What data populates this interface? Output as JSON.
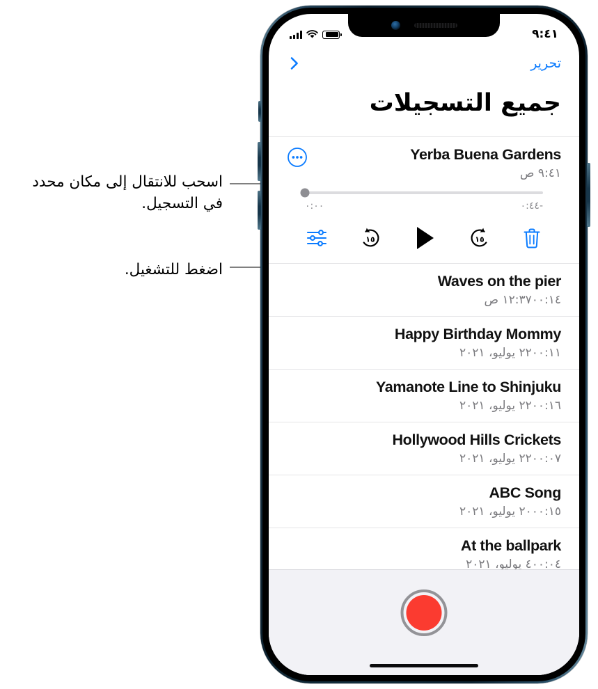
{
  "annotations": [
    {
      "id": "drag-callout",
      "text": "اسحب للانتقال إلى مكان محدد في التسجيل."
    },
    {
      "id": "play-callout",
      "text": "اضغط للتشغيل."
    }
  ],
  "status_bar": {
    "time": "٩:٤١",
    "battery_icon": "battery-icon",
    "wifi_icon": "wifi-icon",
    "cellular_icon": "cellular-signal-icon"
  },
  "nav": {
    "edit_label": "تحرير",
    "back_icon": "chevron-right-icon"
  },
  "header": {
    "title": "جميع التسجيلات"
  },
  "player": {
    "more_icon": "more-circle-icon",
    "elapsed": "٠:٠٠",
    "remaining": "-٠:٤٤",
    "progress_percent": 0,
    "controls": [
      {
        "name": "delete-button",
        "icon": "trash-icon",
        "label": "حذف",
        "color": "#0a7bff"
      },
      {
        "name": "skip-back-button",
        "icon": "skip-back-15-icon",
        "label": "١٥",
        "color": "#000000"
      },
      {
        "name": "play-button",
        "icon": "play-icon",
        "label": "تشغيل",
        "color": "#000000"
      },
      {
        "name": "skip-forward-button",
        "icon": "skip-forward-15-icon",
        "label": "١٥",
        "color": "#000000"
      },
      {
        "name": "options-button",
        "icon": "sliders-icon",
        "label": "خيارات",
        "color": "#0a7bff"
      }
    ]
  },
  "recordings": [
    {
      "title": "Yerba Buena Gardens",
      "date": "٩:٤١ ص",
      "duration": "",
      "selected": true
    },
    {
      "title": "Waves on the pier",
      "date": "١٢:٣٧ ص",
      "duration": "٠٠:١٤",
      "selected": false
    },
    {
      "title": "Happy Birthday Mommy",
      "date": "٢٢ يوليو، ٢٠٢١",
      "duration": "٠٠:١١",
      "selected": false
    },
    {
      "title": "Yamanote Line to Shinjuku",
      "date": "٢٢ يوليو، ٢٠٢١",
      "duration": "٠٠:١٦",
      "selected": false
    },
    {
      "title": "Hollywood Hills Crickets",
      "date": "٢٢ يوليو، ٢٠٢١",
      "duration": "٠٠:٠٧",
      "selected": false
    },
    {
      "title": "ABC Song",
      "date": "٢٠ يوليو، ٢٠٢١",
      "duration": "٠٠:١٥",
      "selected": false
    },
    {
      "title": "At the ballpark",
      "date": "٤ يوليو، ٢٠٢١",
      "duration": "٠٠:٠٤",
      "selected": false
    }
  ],
  "record_bar": {
    "record_icon": "record-button-icon",
    "home_indicator": "home-indicator"
  },
  "colors": {
    "accent_blue": "#0a7bff",
    "record_red": "#fb3b30",
    "secondary_text": "#7a7a7e",
    "separator": "#e4e4e6",
    "record_bar_bg": "#f2f2f6"
  }
}
